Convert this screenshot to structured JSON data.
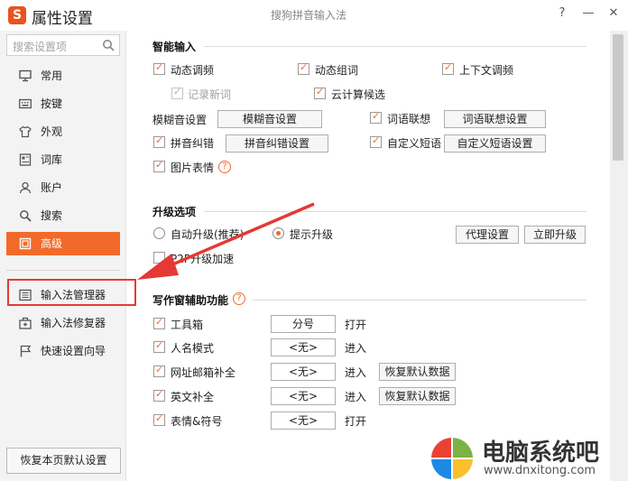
{
  "window": {
    "title": "属性设置",
    "app_name": "搜狗拼音输入法",
    "logo_letter": "S",
    "help_icon": "?",
    "min_icon": "—",
    "close_icon": "✕"
  },
  "sidebar": {
    "search_placeholder": "搜索设置项",
    "items": [
      {
        "label": "常用",
        "icon": "monitor-icon"
      },
      {
        "label": "按键",
        "icon": "keyboard-icon"
      },
      {
        "label": "外观",
        "icon": "shirt-icon"
      },
      {
        "label": "词库",
        "icon": "book-icon"
      },
      {
        "label": "账户",
        "icon": "user-icon"
      },
      {
        "label": "搜索",
        "icon": "search-icon"
      },
      {
        "label": "高级",
        "icon": "advanced-icon",
        "active": true
      }
    ],
    "tools": [
      {
        "label": "输入法管理器",
        "icon": "manager-icon"
      },
      {
        "label": "输入法修复器",
        "icon": "repair-icon"
      },
      {
        "label": "快速设置向导",
        "icon": "flag-icon"
      }
    ],
    "reset_button": "恢复本页默认设置"
  },
  "smart_input": {
    "title": "智能输入",
    "dynamic_freq": "动态调频",
    "dynamic_combo": "动态组词",
    "context_freq": "上下文调频",
    "record_new": "记录新词",
    "cloud_candidates": "云计算候选",
    "fuzzy_label": "模糊音设置",
    "fuzzy_button": "模糊音设置",
    "word_assoc": "词语联想",
    "word_assoc_button": "词语联想设置",
    "pinyin_correct": "拼音纠错",
    "pinyin_correct_button": "拼音纠错设置",
    "custom_phrase": "自定义短语",
    "custom_phrase_button": "自定义短语设置",
    "image_emoji": "图片表情",
    "help_mark": "?"
  },
  "upgrade": {
    "title": "升级选项",
    "auto_upgrade": "自动升级(推荐)",
    "prompt_upgrade": "提示升级",
    "proxy_button": "代理设置",
    "upgrade_now_button": "立即升级",
    "p2p": "P2P升级加速"
  },
  "writing": {
    "title": "写作窗辅助功能",
    "help_mark": "?",
    "rows": [
      {
        "label": "工具箱",
        "value": "分号",
        "action": "打开",
        "reset": ""
      },
      {
        "label": "人名模式",
        "value": "<无>",
        "action": "进入",
        "reset": ""
      },
      {
        "label": "网址邮箱补全",
        "value": "<无>",
        "action": "进入",
        "reset": "恢复默认数据"
      },
      {
        "label": "英文补全",
        "value": "<无>",
        "action": "进入",
        "reset": "恢复默认数据"
      },
      {
        "label": "表情&符号",
        "value": "<无>",
        "action": "打开",
        "reset": ""
      }
    ]
  },
  "watermark": {
    "brand": "电脑系统吧",
    "url": "www.dnxitong.com"
  },
  "colors": {
    "accent": "#f26a2a",
    "highlight_red": "#e53935"
  }
}
